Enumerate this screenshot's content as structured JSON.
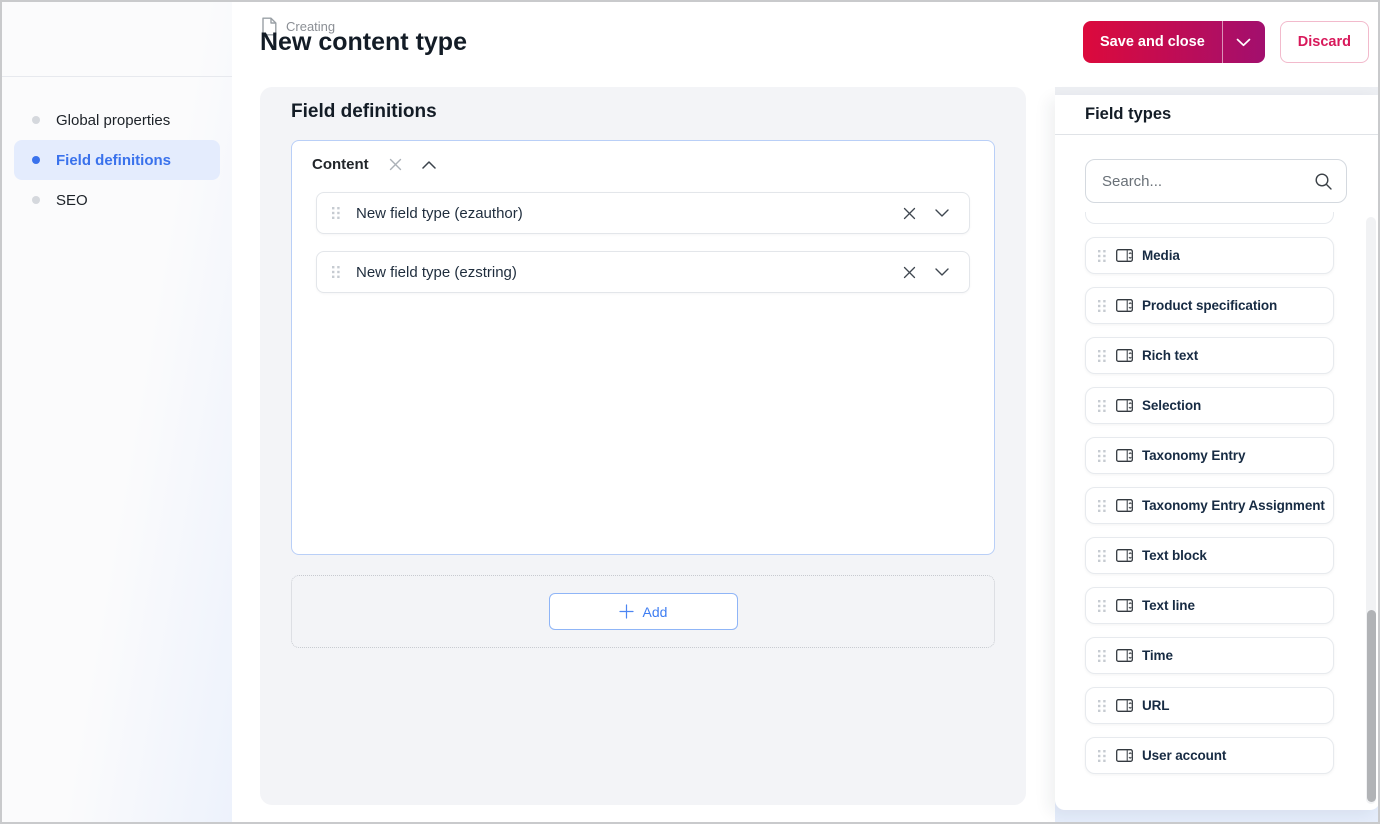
{
  "header": {
    "kicker": "Creating",
    "title": "New content type",
    "save_button": "Save and close",
    "discard_button": "Discard"
  },
  "sidebar": {
    "items": [
      {
        "label": "Global properties",
        "active": false
      },
      {
        "label": "Field definitions",
        "active": true
      },
      {
        "label": "SEO",
        "active": false
      }
    ]
  },
  "main": {
    "heading": "Field definitions",
    "group": {
      "title": "Content",
      "fields": [
        {
          "label": "New field type (ezauthor)"
        },
        {
          "label": "New field type (ezstring)"
        }
      ]
    },
    "add_button": "Add"
  },
  "field_types_panel": {
    "title": "Field types",
    "search_placeholder": "Search...",
    "items": [
      "Media",
      "Product specification",
      "Rich text",
      "Selection",
      "Taxonomy Entry",
      "Taxonomy Entry Assignment",
      "Text block",
      "Text line",
      "Time",
      "URL",
      "User account"
    ]
  },
  "icons": {
    "page": "page-outline",
    "close": "x-cross",
    "chevron_up": "chevron-up",
    "chevron_down": "chevron-down",
    "search": "magnifier",
    "plus": "plus",
    "drag": "six-dot-handle",
    "field_type": "input-field-stepper"
  },
  "colors": {
    "accent_blue": "#3a72ec",
    "active_item_bg": "#e4ecfd",
    "save_gradient_start": "#dc0a3c",
    "save_gradient_end": "#a20f6e",
    "danger_text": "#d8195b",
    "panel_bg": "#f3f4f7",
    "group_border": "#b9cff7",
    "dark_text": "#131c26"
  }
}
